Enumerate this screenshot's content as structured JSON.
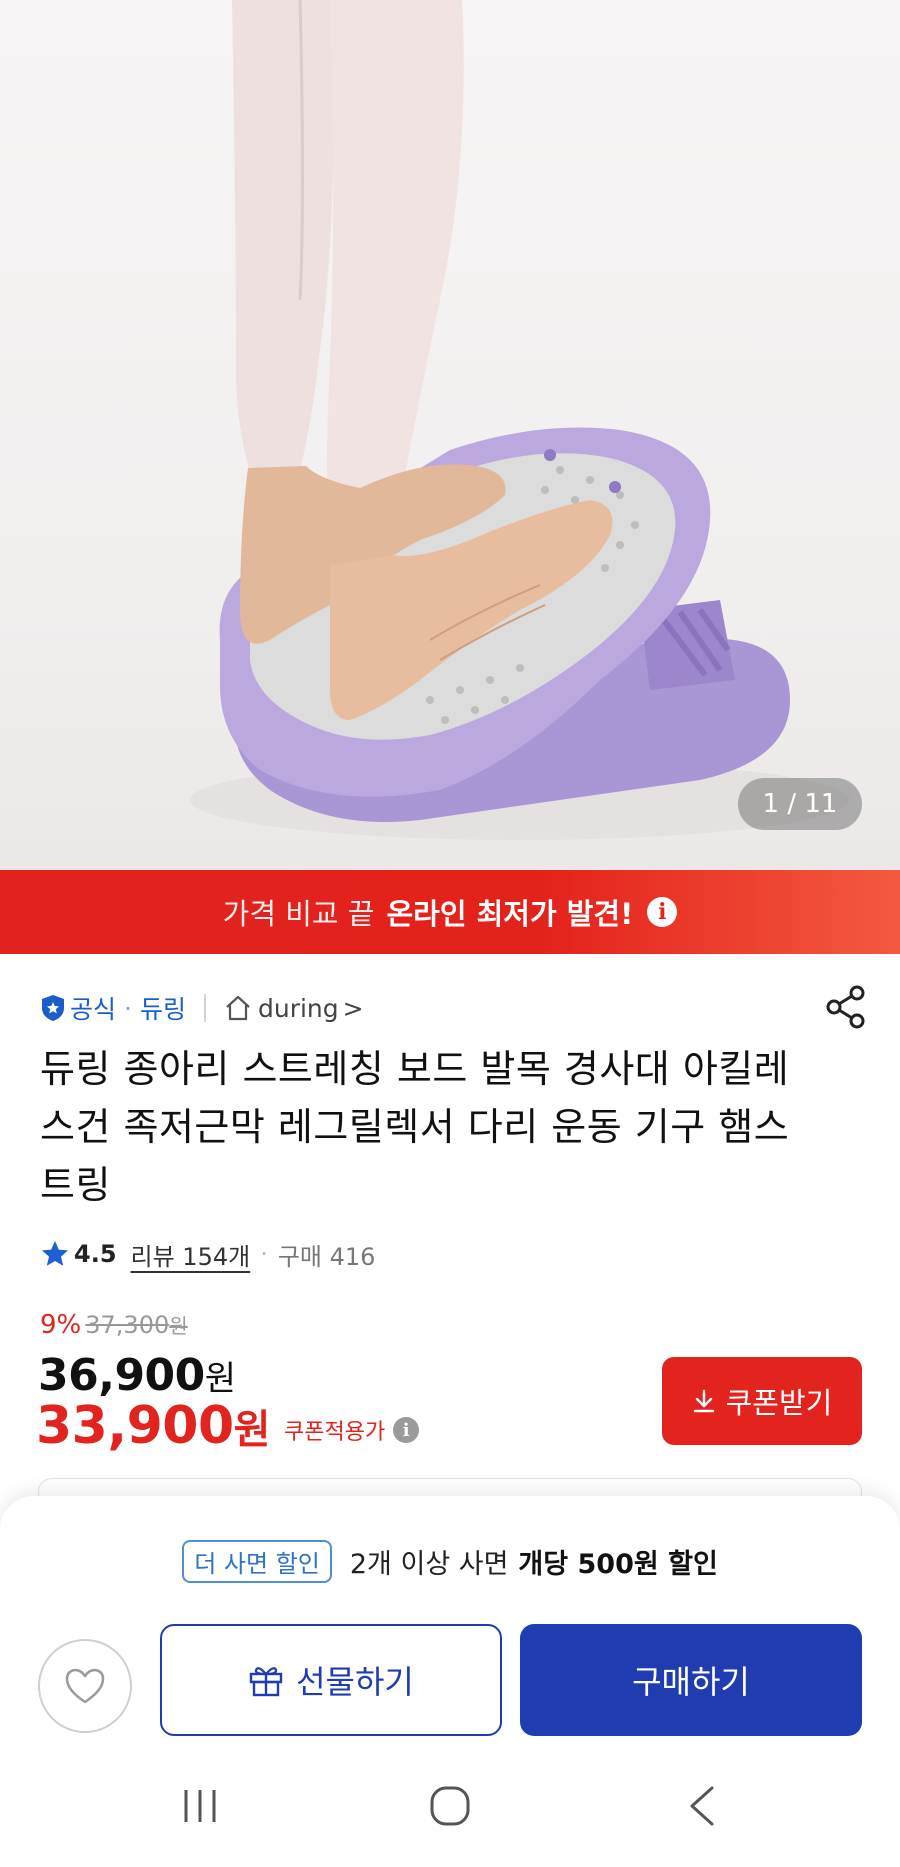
{
  "product_image": {
    "counter": "1 / 11"
  },
  "promo_banner": {
    "text_light": "가격 비교 끝",
    "text_bold": "온라인 최저가 발견!",
    "info_icon": "info-icon"
  },
  "seller": {
    "official_label": "공식",
    "separator": "·",
    "name": "듀링",
    "store_name": "during",
    "store_chevron": ">"
  },
  "product": {
    "title": "듀링 종아리 스트레칭 보드 발목 경사대 아킬레스건 족저근막 레그릴렉서 다리 운동 기구 햄스트링",
    "rating": "4.5",
    "review_label": "리뷰 154개",
    "purchase_label": "구매 416"
  },
  "price": {
    "discount_rate": "9%",
    "original_price": "37,300",
    "original_unit": "원",
    "sale_price": "36,900",
    "sale_unit": "원",
    "coupon_price": "33,900",
    "coupon_unit": "원",
    "coupon_applied_label": "쿠폰적용가",
    "coupon_button_label": "쿠폰받기"
  },
  "bottom_sheet": {
    "bulk_tag": "더 사면 할인",
    "bulk_text": "2개 이상 사면",
    "bulk_strong": "개당 500원 할인",
    "gift_button": "선물하기",
    "buy_button": "구매하기"
  },
  "colors": {
    "accent_red": "#e2231e",
    "brand_blue": "#1f3db0",
    "link_blue": "#1a5ecb",
    "board_purple": "#b9a6da"
  }
}
